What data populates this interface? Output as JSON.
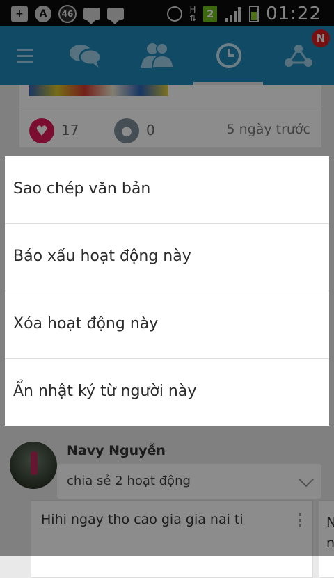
{
  "status_bar": {
    "time": "01:22",
    "network_badge": "46",
    "network_type": "H",
    "sim_slot": "2",
    "colors": {
      "sim_badge": "#6fbf1a",
      "battery": "#8bd219"
    }
  },
  "app_bar": {
    "color": "#1f88b8",
    "tabs": [
      "menu-icon",
      "chat-icon",
      "friends-icon",
      "history-icon",
      "share-icon"
    ],
    "active_tab": "history-icon",
    "notification_badge": "N"
  },
  "feed": {
    "top_card": {
      "likes": "17",
      "comments": "0",
      "time_ago": "5 ngày trước"
    },
    "post": {
      "author": "Navy Nguyễn",
      "shared_summary": "chia sẻ 2 hoạt động",
      "content_preview": "Hihi ngay tho cao gia gia nai ti",
      "next_card_letters": "N\nn"
    }
  },
  "context_menu": {
    "items": [
      "Sao chép văn bản",
      "Báo xấu hoạt động này",
      "Xóa hoạt động này",
      "Ẩn nhật ký từ người này"
    ]
  }
}
